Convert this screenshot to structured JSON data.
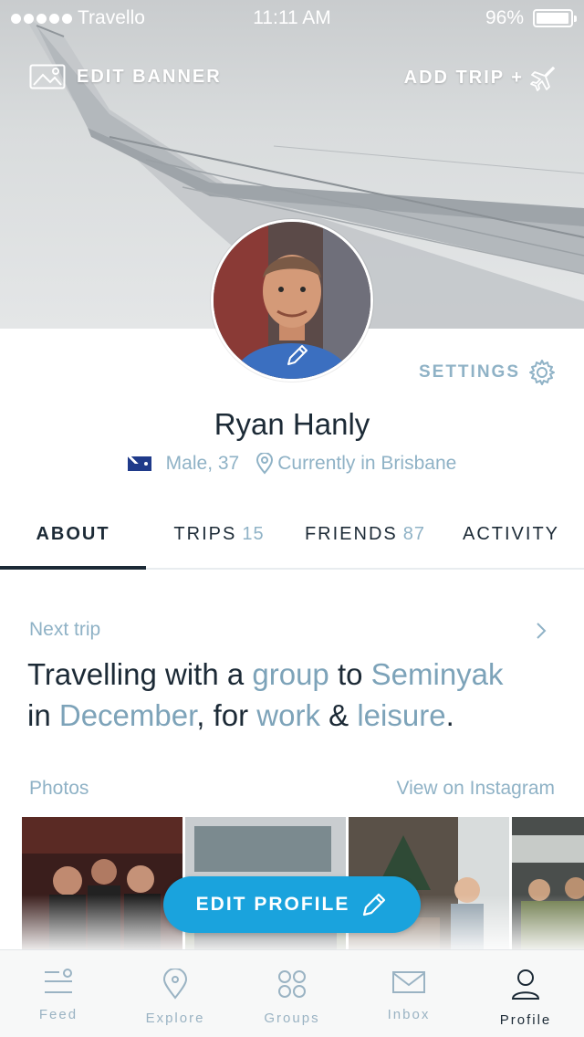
{
  "status_bar": {
    "carrier": "Travello",
    "time": "11:11 AM",
    "battery": "96%",
    "battery_level": 0.96
  },
  "banner": {
    "edit_banner_label": "EDIT BANNER",
    "add_trip_label": "ADD TRIP +"
  },
  "profile": {
    "name": "Ryan Hanly",
    "gender_age": "Male, 37",
    "location": "Currently in Brisbane",
    "settings_label": "SETTINGS"
  },
  "tabs": [
    {
      "label": "ABOUT",
      "count": ""
    },
    {
      "label": "TRIPS",
      "count": "15"
    },
    {
      "label": "FRIENDS",
      "count": "87"
    },
    {
      "label": "ACTIVITY",
      "count": ""
    }
  ],
  "next_trip": {
    "label": "Next trip",
    "t1": "Travelling with a ",
    "group": "group",
    "t2": " to ",
    "destination": "Seminyak",
    "t3": "in ",
    "month": "December",
    "t4": ", for ",
    "purpose1": "work",
    "t5": " & ",
    "purpose2": "leisure",
    "t6": "."
  },
  "photos": {
    "label": "Photos",
    "instagram_link": "View on Instagram"
  },
  "edit_profile_label": "EDIT PROFILE",
  "bottom_nav": [
    {
      "label": "Feed",
      "icon": "feed-icon"
    },
    {
      "label": "Explore",
      "icon": "location-pin-icon"
    },
    {
      "label": "Groups",
      "icon": "groups-icon"
    },
    {
      "label": "Inbox",
      "icon": "envelope-icon"
    },
    {
      "label": "Profile",
      "icon": "person-icon"
    }
  ],
  "colors": {
    "accent": "#1aa3dd",
    "muted": "#8fb2c6",
    "text": "#1c2a36"
  }
}
